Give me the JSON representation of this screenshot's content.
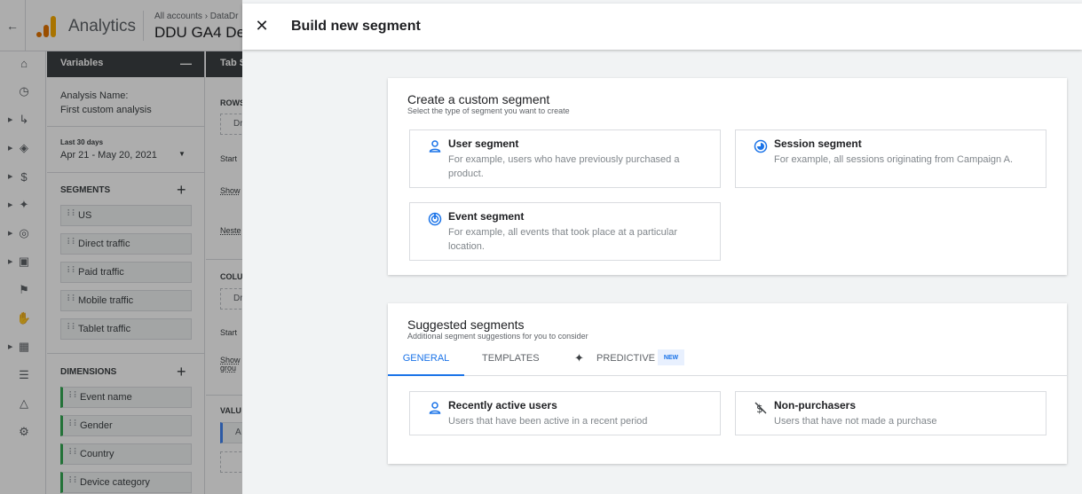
{
  "app": {
    "name": "Analytics",
    "breadcrumb": "All accounts › DataDr",
    "property": "DDU GA4 De"
  },
  "variables": {
    "header": "Variables",
    "analysis_name_label": "Analysis Name:",
    "analysis_name": "First custom analysis",
    "date_range_label": "Last 30 days",
    "date_range": "Apr 21 - May 20, 2021",
    "segments_heading": "SEGMENTS",
    "segments": [
      "US",
      "Direct traffic",
      "Paid traffic",
      "Mobile traffic",
      "Tablet traffic"
    ],
    "dimensions_heading": "DIMENSIONS",
    "dimensions": [
      "Event name",
      "Gender",
      "Country",
      "Device category"
    ]
  },
  "tab_settings": {
    "header": "Tab S",
    "rows": "ROWS",
    "drop": "Dr",
    "start": "Start",
    "show": "Show",
    "nested": "Neste",
    "columns": "COLU",
    "show_group": "Show grou",
    "values": "VALU",
    "value_item": "A"
  },
  "dialog": {
    "title": "Build new segment",
    "custom": {
      "title": "Create a custom segment",
      "subtitle": "Select the type of segment you want to create",
      "options": [
        {
          "icon": "person-icon",
          "title": "User segment",
          "desc": "For example, users who have previously purchased a product."
        },
        {
          "icon": "session-icon",
          "title": "Session segment",
          "desc": "For example, all sessions originating from Campaign A."
        },
        {
          "icon": "event-icon",
          "title": "Event segment",
          "desc": "For example, all events that took place at a particular location."
        }
      ]
    },
    "suggested": {
      "title": "Suggested segments",
      "subtitle": "Additional segment suggestions for you to consider",
      "tabs": [
        "GENERAL",
        "TEMPLATES",
        "PREDICTIVE"
      ],
      "new_badge": "NEW",
      "options": [
        {
          "icon": "person-icon",
          "title": "Recently active users",
          "desc": "Users that have been active in a recent period"
        },
        {
          "icon": "no-purchase-icon",
          "title": "Non-purchasers",
          "desc": "Users that have not made a purchase"
        }
      ]
    }
  },
  "colors": {
    "accent": "#1a73e8",
    "dark_header": "#3c4043",
    "logo_orange": "#e37400",
    "logo_yellow": "#f9ab00",
    "dimension_green": "#34a853"
  }
}
